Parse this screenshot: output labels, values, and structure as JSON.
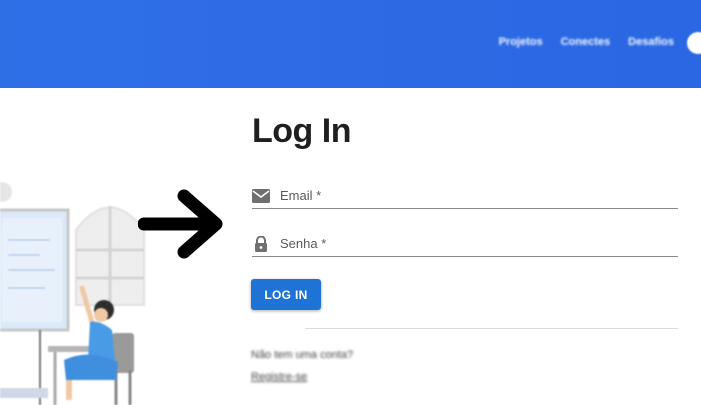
{
  "header": {
    "nav": [
      {
        "label": "Projetos"
      },
      {
        "label": "Conectes"
      },
      {
        "label": "Desafios"
      }
    ],
    "bg_color": "#2f6fe6"
  },
  "login": {
    "title": "Log In",
    "email_placeholder": "Email *",
    "password_placeholder": "Senha *",
    "button_label": "LOG IN",
    "no_account_text": "Não tem uma conta?",
    "register_label": "Registre-se",
    "accent_color": "#1f72d6"
  },
  "icons": {
    "email": "envelope-icon",
    "password": "lock-icon",
    "arrow": "right-arrow-icon"
  }
}
